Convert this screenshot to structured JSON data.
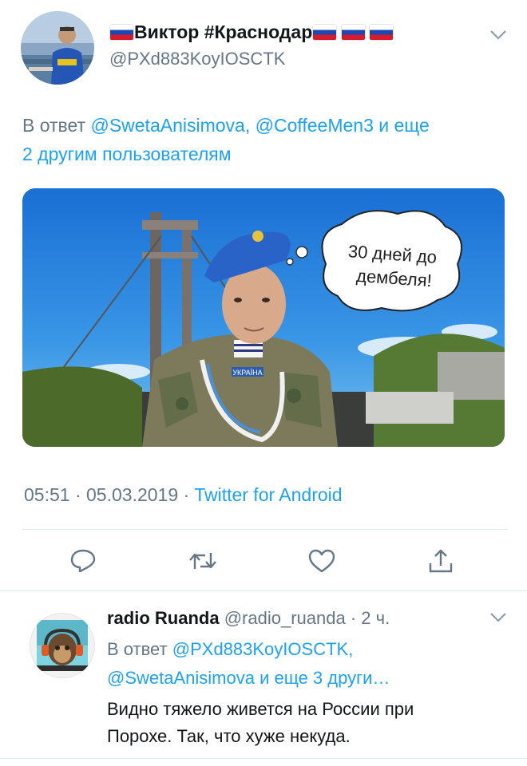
{
  "tweet": {
    "author_name": "Виктор #Краснодар",
    "flag_count_after_name": 3,
    "handle": "@PXd883KoyIOSCTK",
    "reply_prefix": "В ответ",
    "reply_mention_1": "@SwetaAnisimova,",
    "reply_mention_2": "@CoffeeMen3",
    "reply_suffix_1": "и еще",
    "reply_suffix_2": "2 другим пользователям",
    "image": {
      "bubble_text_line1": "30 дней до",
      "bubble_text_line2": "дембеля!",
      "patch_text": "УКРАЇНА"
    },
    "time": "05:51",
    "sep": "·",
    "date": "05.03.2019",
    "source": "Twitter for Android",
    "actions": [
      "reply-icon",
      "retweet-icon",
      "like-icon",
      "share-icon"
    ]
  },
  "reply": {
    "author_name": "radio Ruanda",
    "handle": "@radio_ruanda",
    "time_ago": "· 2 ч.",
    "reply_prefix": "В ответ",
    "mention_1": "@PXd883KoyIOSCTK,",
    "mention_2": "@SwetaAnisimova",
    "mention_suffix": "и еще 3 други…",
    "text_line1": "Видно тяжело живется на России при",
    "text_line2": "Порохе. Так, что хуже некуда."
  },
  "colors": {
    "link": "#1da1f2",
    "secondary": "#657786",
    "text": "#14171a",
    "divider": "#e1e8ed"
  }
}
